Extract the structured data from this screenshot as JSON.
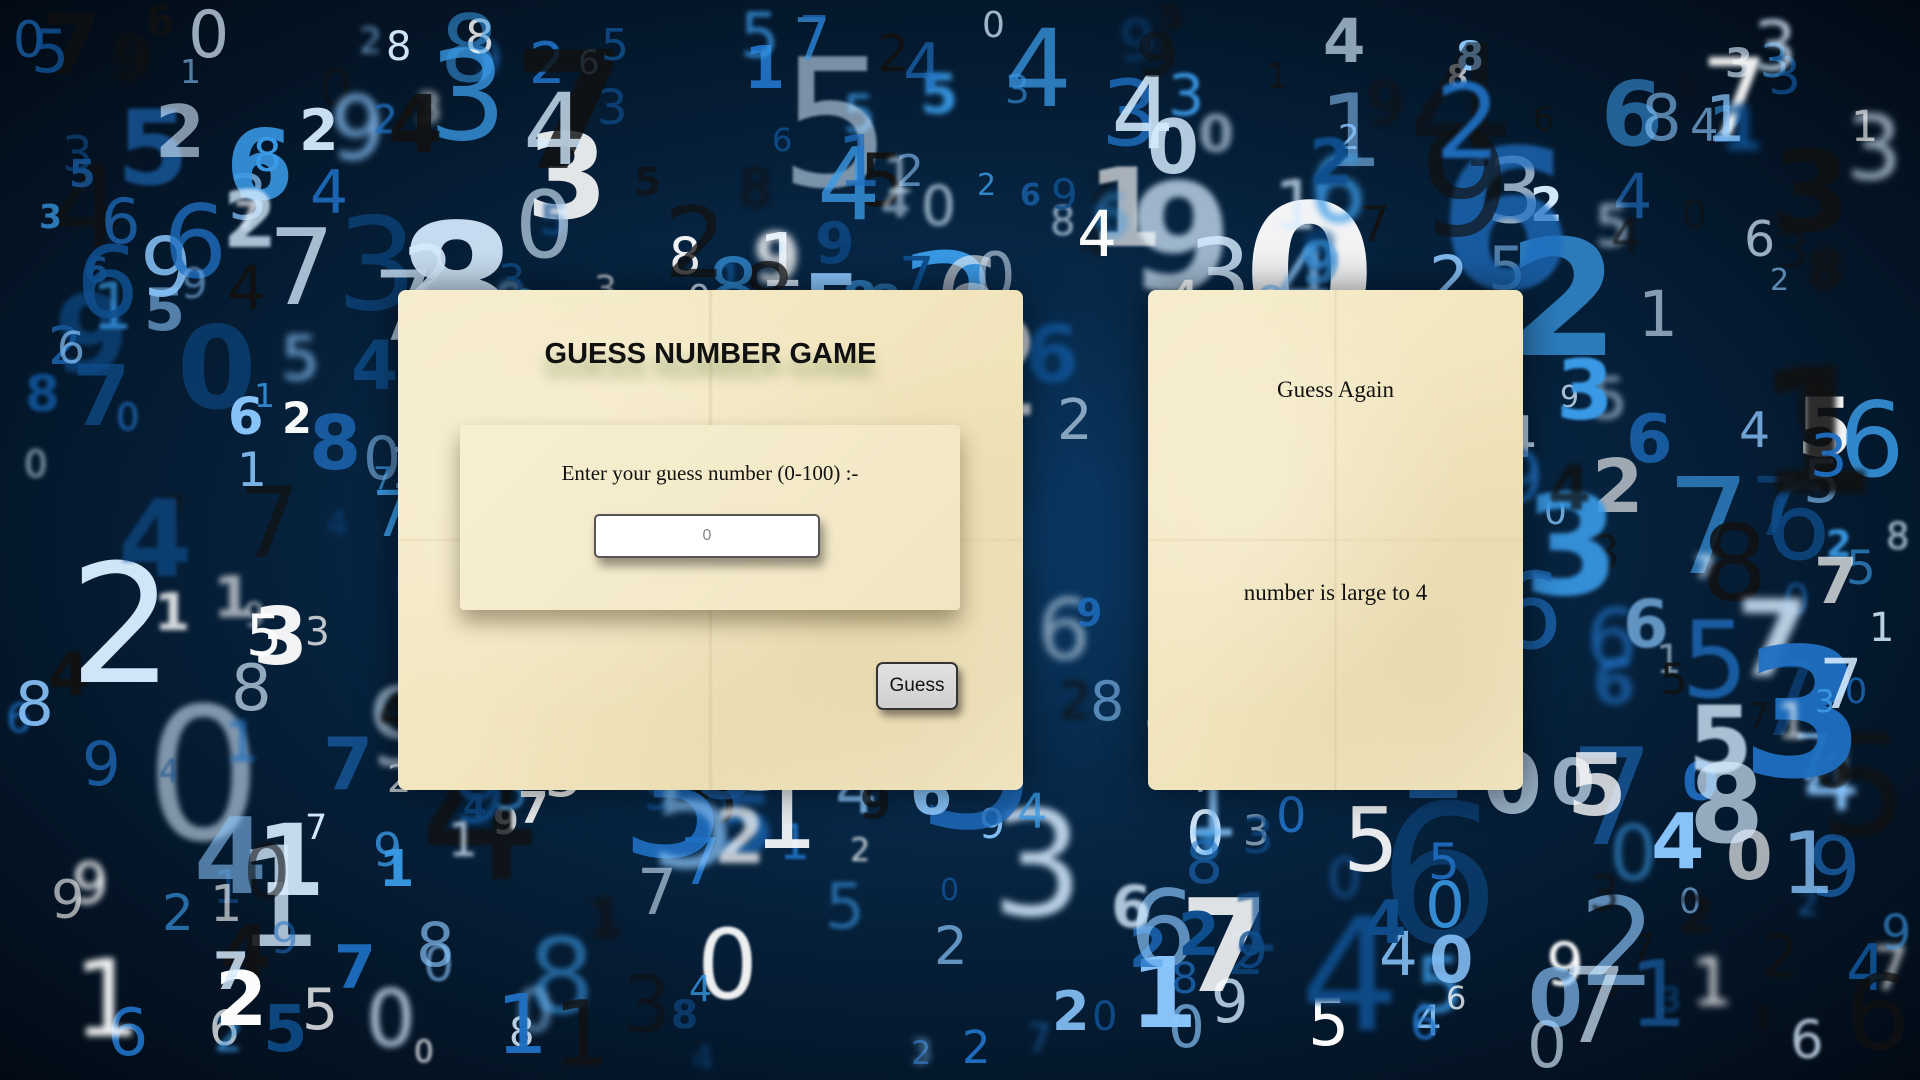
{
  "background": {
    "description_icon": "digit-pattern",
    "colors": [
      "#ffffff",
      "#d7ecff",
      "#8cc8ff",
      "#3a9be8",
      "#1f6fc2",
      "#0f4f8f",
      "#111111"
    ]
  },
  "game": {
    "title": "GUESS NUMBER GAME",
    "prompt": "Enter your guess number (0-100) :-",
    "input_placeholder": "0",
    "input_value": "",
    "button_label": "Guess"
  },
  "result": {
    "heading": "Guess Again",
    "message": "number is large to 4"
  }
}
